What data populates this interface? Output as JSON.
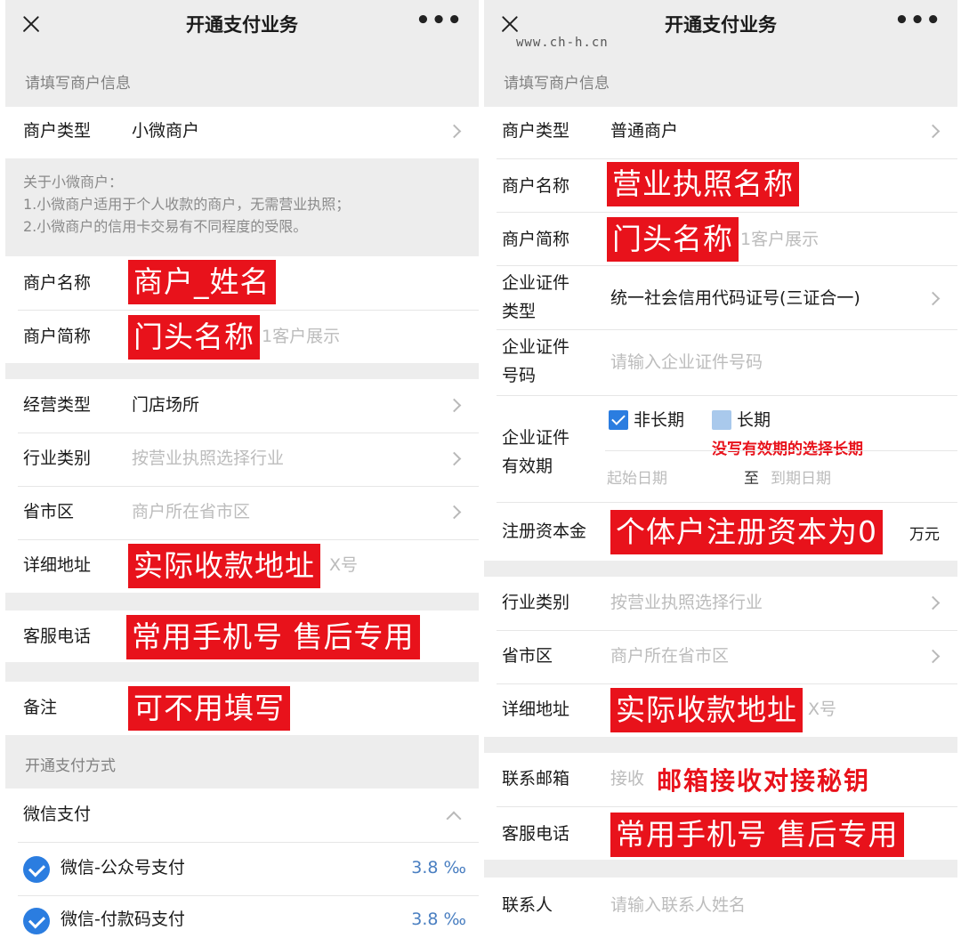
{
  "left": {
    "nav": {
      "title": "开通支付业务",
      "more": "•••"
    },
    "section_merchant": "请填写商户信息",
    "merchant_type": {
      "label": "商户类型",
      "value": "小微商户"
    },
    "note": {
      "title": "关于小微商户：",
      "line1": "1.小微商户适用于个人收款的商户，无需营业执照；",
      "line2": "2.小微商户的信用卡交易有不同程度的受限。"
    },
    "merchant_name": {
      "label": "商户名称",
      "overlay": "商户_姓名"
    },
    "merchant_short": {
      "label": "商户简称",
      "overlay": "门头名称",
      "placeholder_tail": "1客户展示"
    },
    "business_type": {
      "label": "经营类型",
      "value": "门店场所"
    },
    "industry": {
      "label": "行业类别",
      "placeholder": "按营业执照选择行业"
    },
    "region": {
      "label": "省市区",
      "placeholder": "商户所在省市区"
    },
    "address": {
      "label": "详细地址",
      "overlay": "实际收款地址",
      "placeholder_tail": "X号"
    },
    "service_phone": {
      "label": "客服电话",
      "overlay": "常用手机号 售后专用"
    },
    "remark": {
      "label": "备注",
      "overlay": "可不用填写"
    },
    "section_payment": "开通支付方式",
    "wechat_pay": {
      "label": "微信支付"
    },
    "pay_methods": [
      {
        "label": "微信-公众号支付",
        "rate": "3.8 ‰"
      },
      {
        "label": "微信-付款码支付",
        "rate": "3.8 ‰"
      }
    ]
  },
  "right": {
    "nav": {
      "title": "开通支付业务",
      "more": "•••"
    },
    "watermark": "www.ch-h.cn",
    "section_merchant": "请填写商户信息",
    "merchant_type": {
      "label": "商户类型",
      "value": "普通商户"
    },
    "merchant_name": {
      "label": "商户名称",
      "overlay": "营业执照名称"
    },
    "merchant_short": {
      "label": "商户简称",
      "overlay": "门头名称",
      "placeholder_tail": "1客户展示"
    },
    "cert_type": {
      "label_line1": "企业证件",
      "label_line2": "类型",
      "value": "统一社会信用代码证号(三证合一)"
    },
    "cert_number": {
      "label_line1": "企业证件",
      "label_line2": "号码",
      "placeholder": "请输入企业证件号码"
    },
    "cert_validity": {
      "label_line1": "企业证件",
      "label_line2": "有效期",
      "option_non_long": "非长期",
      "option_long": "长期",
      "note": "没写有效期的选择长期",
      "start_placeholder": "起始日期",
      "separator": "至",
      "end_placeholder": "到期日期"
    },
    "registered_capital": {
      "label": "注册资本金",
      "overlay": "个体户注册资本为0",
      "unit": "万元"
    },
    "industry": {
      "label": "行业类别",
      "placeholder": "按营业执照选择行业"
    },
    "region": {
      "label": "省市区",
      "placeholder": "商户所在省市区"
    },
    "address": {
      "label": "详细地址",
      "overlay": "实际收款地址",
      "placeholder_tail": "X号"
    },
    "email": {
      "label": "联系邮箱",
      "placeholder_head": "接收",
      "note": "邮箱接收对接秘钥"
    },
    "service_phone": {
      "label": "客服电话",
      "overlay": "常用手机号 售后专用"
    },
    "contact": {
      "label": "联系人",
      "placeholder": "请输入联系人姓名"
    }
  }
}
